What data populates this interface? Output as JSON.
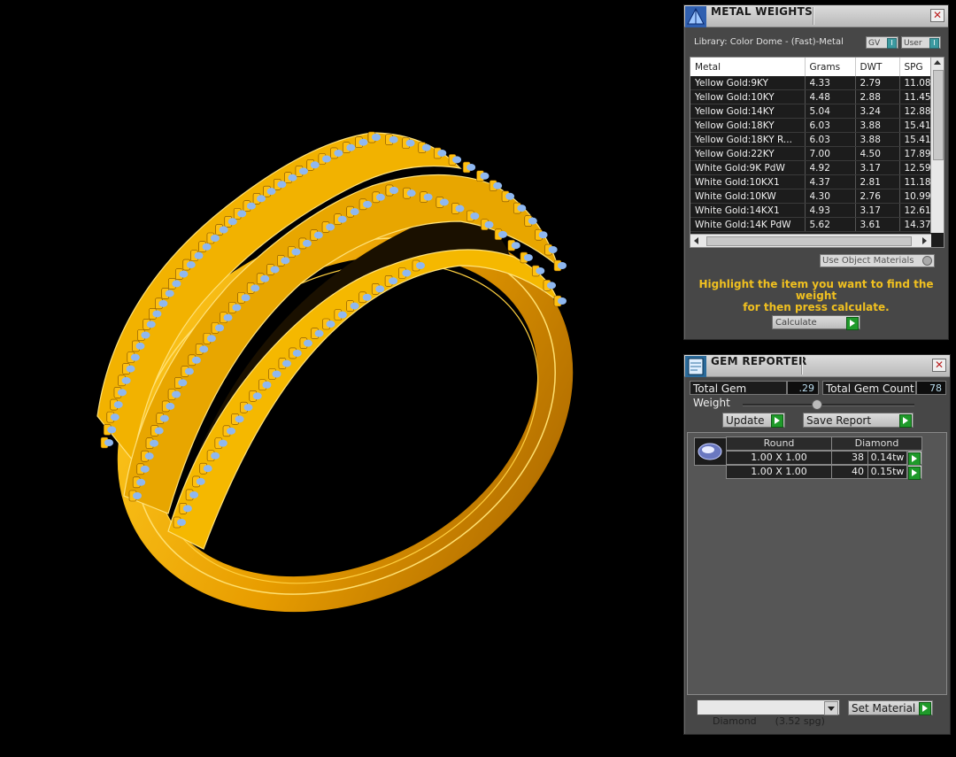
{
  "metal_weights": {
    "title": "METAL WEIGHTS",
    "library": "Library: Color Dome - (Fast)-Metal",
    "toggle_gv": "GV",
    "toggle_user": "User",
    "toggle_knob": "I",
    "columns": [
      "Metal",
      "Grams",
      "DWT",
      "SPG"
    ],
    "rows": [
      [
        "Yellow Gold:9KY",
        "4.33",
        "2.79",
        "11.08"
      ],
      [
        "Yellow Gold:10KY",
        "4.48",
        "2.88",
        "11.45"
      ],
      [
        "Yellow Gold:14KY",
        "5.04",
        "3.24",
        "12.88"
      ],
      [
        "Yellow Gold:18KY",
        "6.03",
        "3.88",
        "15.41"
      ],
      [
        "Yellow Gold:18KY R...",
        "6.03",
        "3.88",
        "15.41"
      ],
      [
        "Yellow Gold:22KY",
        "7.00",
        "4.50",
        "17.89"
      ],
      [
        "White Gold:9K PdW",
        "4.92",
        "3.17",
        "12.59"
      ],
      [
        "White Gold:10KX1",
        "4.37",
        "2.81",
        "11.18"
      ],
      [
        "White Gold:10KW",
        "4.30",
        "2.76",
        "10.99"
      ],
      [
        "White Gold:14KX1",
        "4.93",
        "3.17",
        "12.61"
      ],
      [
        "White Gold:14K PdW",
        "5.62",
        "3.61",
        "14.37"
      ]
    ],
    "use_object_materials": "Use Object Materials",
    "instruction_line1": "Highlight the item you want to find the weight",
    "instruction_line2": "for then press calculate.",
    "calculate_label": "Calculate",
    "close": "✕"
  },
  "gem_reporter": {
    "title": "GEM REPORTER",
    "total_weight_label": "Total Gem Weight",
    "total_weight_value": ".29",
    "total_count_label": "Total Gem Count",
    "total_count_value": "78",
    "update_label": "Update",
    "save_report_label": "Save Report",
    "header_shape": "Round",
    "header_material": "Diamond",
    "gems": [
      {
        "size": "1.00 X 1.00",
        "count": "38",
        "weight": "0.14tw"
      },
      {
        "size": "1.00 X 1.00",
        "count": "40",
        "weight": "0.15tw"
      }
    ],
    "material_select": "Diamond      (3.52 spg)",
    "set_material_label": "Set Material",
    "close": "✕"
  },
  "colors": {
    "gold": "#f5b300",
    "gold_dark": "#b87800",
    "gem_blue": "#8fb8f0",
    "panel_bg": "#474747",
    "accent_yellow": "#f0c020",
    "go_green": "#1f9a2a"
  }
}
